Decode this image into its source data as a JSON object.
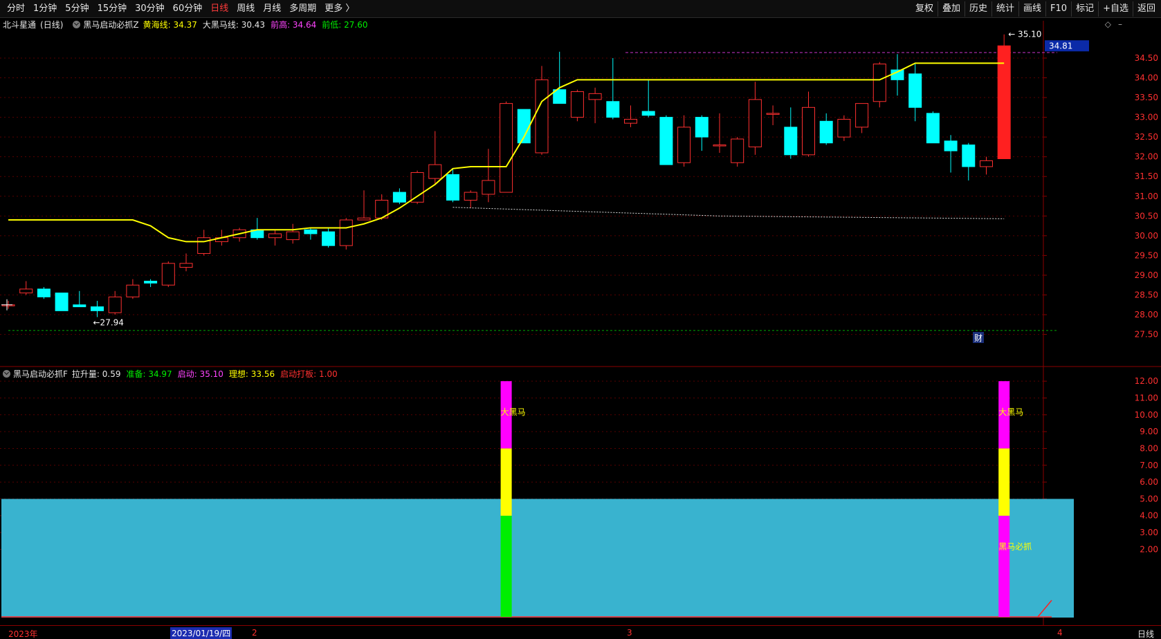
{
  "toolbar": {
    "tabs": [
      {
        "label": "分时",
        "active": false
      },
      {
        "label": "1分钟",
        "active": false
      },
      {
        "label": "5分钟",
        "active": false
      },
      {
        "label": "15分钟",
        "active": false
      },
      {
        "label": "30分钟",
        "active": false
      },
      {
        "label": "60分钟",
        "active": false
      },
      {
        "label": "日线",
        "active": true
      },
      {
        "label": "周线",
        "active": false
      },
      {
        "label": "月线",
        "active": false
      },
      {
        "label": "多周期",
        "active": false
      },
      {
        "label": "更多 〉",
        "active": false
      }
    ],
    "tools": [
      "复权",
      "叠加",
      "历史",
      "统计",
      "画线",
      "F10",
      "标记",
      "+自选",
      "返回"
    ]
  },
  "main": {
    "stock_name": "北斗星通",
    "period": "(日线)",
    "indicator_name": "黑马启动必抓Z",
    "fields": [
      {
        "label": "黄海线:",
        "value": "34.37",
        "color": "#ffff00"
      },
      {
        "label": "大黑马线:",
        "value": "30.43",
        "color": "#e6e6e6"
      },
      {
        "label": "前高:",
        "value": "34.64",
        "color": "#ff44ff"
      },
      {
        "label": "前低:",
        "value": "27.60",
        "color": "#00ee00"
      }
    ],
    "current_price_tag": "34.81",
    "high_marker": "35.10",
    "low_marker": "27.94",
    "finance_badge": "财"
  },
  "indicator": {
    "name": "黑马启动必抓F",
    "fields": [
      {
        "label": "拉升量:",
        "value": "0.59",
        "color": "#e6e6e6"
      },
      {
        "label": "准备:",
        "value": "34.97",
        "color": "#00ee00"
      },
      {
        "label": "启动:",
        "value": "35.10",
        "color": "#ff44ff"
      },
      {
        "label": "理想:",
        "value": "33.56",
        "color": "#ffff00"
      },
      {
        "label": "启动打板:",
        "value": "1.00",
        "color": "#ff3030"
      }
    ],
    "bar_labels": [
      "大黑马",
      "大黑马",
      "黑马必抓"
    ]
  },
  "time_axis": {
    "labels": [
      "2023年",
      "2023/01/19/四",
      "2",
      "3",
      "4"
    ],
    "period_label": "日线"
  },
  "chart_data": [
    {
      "type": "candlestick",
      "title": "北斗星通 (日线)",
      "ylim": [
        27.3,
        35.2
      ],
      "y_ticks": [
        "27.50",
        "28.00",
        "28.50",
        "29.00",
        "29.50",
        "30.00",
        "30.50",
        "31.00",
        "31.50",
        "32.00",
        "32.50",
        "33.00",
        "33.50",
        "34.00",
        "34.50",
        "34.81"
      ],
      "colors": {
        "up": "#ff3030",
        "down": "#00ffff",
        "yellow_line": "#ffff00",
        "grid": "#5a0000"
      },
      "candles": [
        {
          "o": 28.25,
          "h": 28.35,
          "l": 28.15,
          "c": 28.25
        },
        {
          "o": 28.55,
          "h": 28.85,
          "l": 28.5,
          "c": 28.65
        },
        {
          "o": 28.65,
          "h": 28.7,
          "l": 28.4,
          "c": 28.45
        },
        {
          "o": 28.55,
          "h": 28.55,
          "l": 28.1,
          "c": 28.1
        },
        {
          "o": 28.25,
          "h": 28.6,
          "l": 28.2,
          "c": 28.2
        },
        {
          "o": 28.2,
          "h": 28.35,
          "l": 27.94,
          "c": 28.1
        },
        {
          "o": 28.05,
          "h": 28.6,
          "l": 28.0,
          "c": 28.45
        },
        {
          "o": 28.45,
          "h": 28.9,
          "l": 28.4,
          "c": 28.75
        },
        {
          "o": 28.85,
          "h": 28.9,
          "l": 28.7,
          "c": 28.8
        },
        {
          "o": 28.75,
          "h": 29.35,
          "l": 28.7,
          "c": 29.3
        },
        {
          "o": 29.2,
          "h": 29.55,
          "l": 29.1,
          "c": 29.3
        },
        {
          "o": 29.55,
          "h": 30.15,
          "l": 29.5,
          "c": 29.95
        },
        {
          "o": 29.85,
          "h": 30.15,
          "l": 29.75,
          "c": 29.95
        },
        {
          "o": 29.95,
          "h": 30.2,
          "l": 29.85,
          "c": 30.15
        },
        {
          "o": 30.15,
          "h": 30.45,
          "l": 29.9,
          "c": 29.95
        },
        {
          "o": 29.95,
          "h": 30.15,
          "l": 29.75,
          "c": 30.05
        },
        {
          "o": 29.9,
          "h": 30.3,
          "l": 29.8,
          "c": 30.1
        },
        {
          "o": 30.15,
          "h": 30.2,
          "l": 29.9,
          "c": 30.05
        },
        {
          "o": 30.1,
          "h": 30.2,
          "l": 29.7,
          "c": 29.75
        },
        {
          "o": 29.75,
          "h": 30.45,
          "l": 29.65,
          "c": 30.4
        },
        {
          "o": 30.4,
          "h": 31.15,
          "l": 30.4,
          "c": 30.45
        },
        {
          "o": 30.45,
          "h": 31.05,
          "l": 30.4,
          "c": 30.9
        },
        {
          "o": 31.1,
          "h": 31.2,
          "l": 30.8,
          "c": 30.85
        },
        {
          "o": 30.85,
          "h": 31.65,
          "l": 30.8,
          "c": 31.6
        },
        {
          "o": 31.45,
          "h": 32.65,
          "l": 31.3,
          "c": 31.8
        },
        {
          "o": 31.55,
          "h": 31.7,
          "l": 30.85,
          "c": 30.9
        },
        {
          "o": 30.9,
          "h": 31.15,
          "l": 30.7,
          "c": 31.1
        },
        {
          "o": 31.05,
          "h": 32.2,
          "l": 30.85,
          "c": 31.4
        },
        {
          "o": 31.1,
          "h": 33.4,
          "l": 31.1,
          "c": 33.35
        },
        {
          "o": 33.2,
          "h": 33.2,
          "l": 32.35,
          "c": 32.35
        },
        {
          "o": 32.1,
          "h": 34.3,
          "l": 32.05,
          "c": 33.95
        },
        {
          "o": 33.7,
          "h": 34.66,
          "l": 33.35,
          "c": 33.35
        },
        {
          "o": 33.0,
          "h": 33.7,
          "l": 32.9,
          "c": 33.65
        },
        {
          "o": 33.45,
          "h": 33.75,
          "l": 32.85,
          "c": 33.6
        },
        {
          "o": 33.4,
          "h": 34.5,
          "l": 32.95,
          "c": 33.0
        },
        {
          "o": 32.85,
          "h": 33.3,
          "l": 32.75,
          "c": 32.95
        },
        {
          "o": 33.15,
          "h": 33.95,
          "l": 33.0,
          "c": 33.05
        },
        {
          "o": 33.0,
          "h": 33.05,
          "l": 31.8,
          "c": 31.8
        },
        {
          "o": 31.85,
          "h": 33.05,
          "l": 31.75,
          "c": 32.75
        },
        {
          "o": 33.0,
          "h": 33.05,
          "l": 32.15,
          "c": 32.5
        },
        {
          "o": 32.3,
          "h": 33.1,
          "l": 32.1,
          "c": 32.3
        },
        {
          "o": 31.85,
          "h": 32.5,
          "l": 31.75,
          "c": 32.45
        },
        {
          "o": 32.25,
          "h": 33.9,
          "l": 32.05,
          "c": 33.45
        },
        {
          "o": 33.1,
          "h": 33.3,
          "l": 32.8,
          "c": 33.1
        },
        {
          "o": 32.75,
          "h": 33.25,
          "l": 31.95,
          "c": 32.05
        },
        {
          "o": 32.05,
          "h": 33.65,
          "l": 32.0,
          "c": 33.25
        },
        {
          "o": 32.9,
          "h": 33.1,
          "l": 32.3,
          "c": 32.35
        },
        {
          "o": 32.5,
          "h": 33.05,
          "l": 32.4,
          "c": 32.95
        },
        {
          "o": 32.75,
          "h": 33.35,
          "l": 32.6,
          "c": 33.35
        },
        {
          "o": 33.4,
          "h": 34.4,
          "l": 33.25,
          "c": 34.35
        },
        {
          "o": 34.2,
          "h": 34.6,
          "l": 33.55,
          "c": 33.95
        },
        {
          "o": 34.1,
          "h": 34.35,
          "l": 32.9,
          "c": 33.25
        },
        {
          "o": 33.1,
          "h": 33.15,
          "l": 32.35,
          "c": 32.35
        },
        {
          "o": 32.4,
          "h": 32.55,
          "l": 31.6,
          "c": 32.15
        },
        {
          "o": 32.3,
          "h": 32.35,
          "l": 31.4,
          "c": 31.75
        },
        {
          "o": 31.75,
          "h": 32.0,
          "l": 31.55,
          "c": 31.9
        },
        {
          "o": 31.95,
          "h": 35.1,
          "l": 31.95,
          "c": 34.81
        }
      ],
      "yellow_line": [
        30.4,
        30.4,
        30.4,
        30.4,
        30.4,
        30.4,
        30.4,
        30.4,
        30.25,
        29.95,
        29.85,
        29.85,
        29.95,
        30.05,
        30.15,
        30.15,
        30.15,
        30.2,
        30.2,
        30.2,
        30.3,
        30.45,
        30.7,
        31.0,
        31.3,
        31.7,
        31.75,
        31.75,
        31.75,
        32.5,
        33.4,
        33.75,
        33.95,
        33.95,
        33.95,
        33.95,
        33.95,
        33.95,
        33.95,
        33.95,
        33.95,
        33.95,
        33.95,
        33.95,
        33.95,
        33.95,
        33.95,
        33.95,
        33.95,
        33.95,
        34.15,
        34.37,
        34.37,
        34.37,
        34.37,
        34.37,
        34.37
      ],
      "dashed_white_start_index": 25,
      "dashed_white": [
        30.72,
        30.5,
        30.43
      ],
      "prev_high_line": 34.64,
      "prev_low_line": 27.6
    },
    {
      "type": "bar",
      "title": "黑马启动必抓F",
      "ylim": [
        0,
        12.5
      ],
      "y_ticks": [
        "2.00",
        "3.00",
        "4.00",
        "5.00",
        "6.00",
        "7.00",
        "8.00",
        "9.00",
        "10.00",
        "11.00",
        "12.00"
      ],
      "area_level": 5.0,
      "area_color": "#39b3cf",
      "stacked_bars": [
        {
          "index": 28,
          "segments": [
            {
              "from": 0,
              "to": 4,
              "color": "#00ee00"
            },
            {
              "from": 4,
              "to": 8,
              "color": "#ffff00"
            },
            {
              "from": 8,
              "to": 12,
              "color": "#ff00ff"
            }
          ]
        },
        {
          "index": 56,
          "segments": [
            {
              "from": 0,
              "to": 4,
              "color": "#ff00ff"
            },
            {
              "from": 4,
              "to": 8,
              "color": "#ffff00"
            },
            {
              "from": 8,
              "to": 12,
              "color": "#ff00ff"
            }
          ]
        }
      ]
    }
  ]
}
